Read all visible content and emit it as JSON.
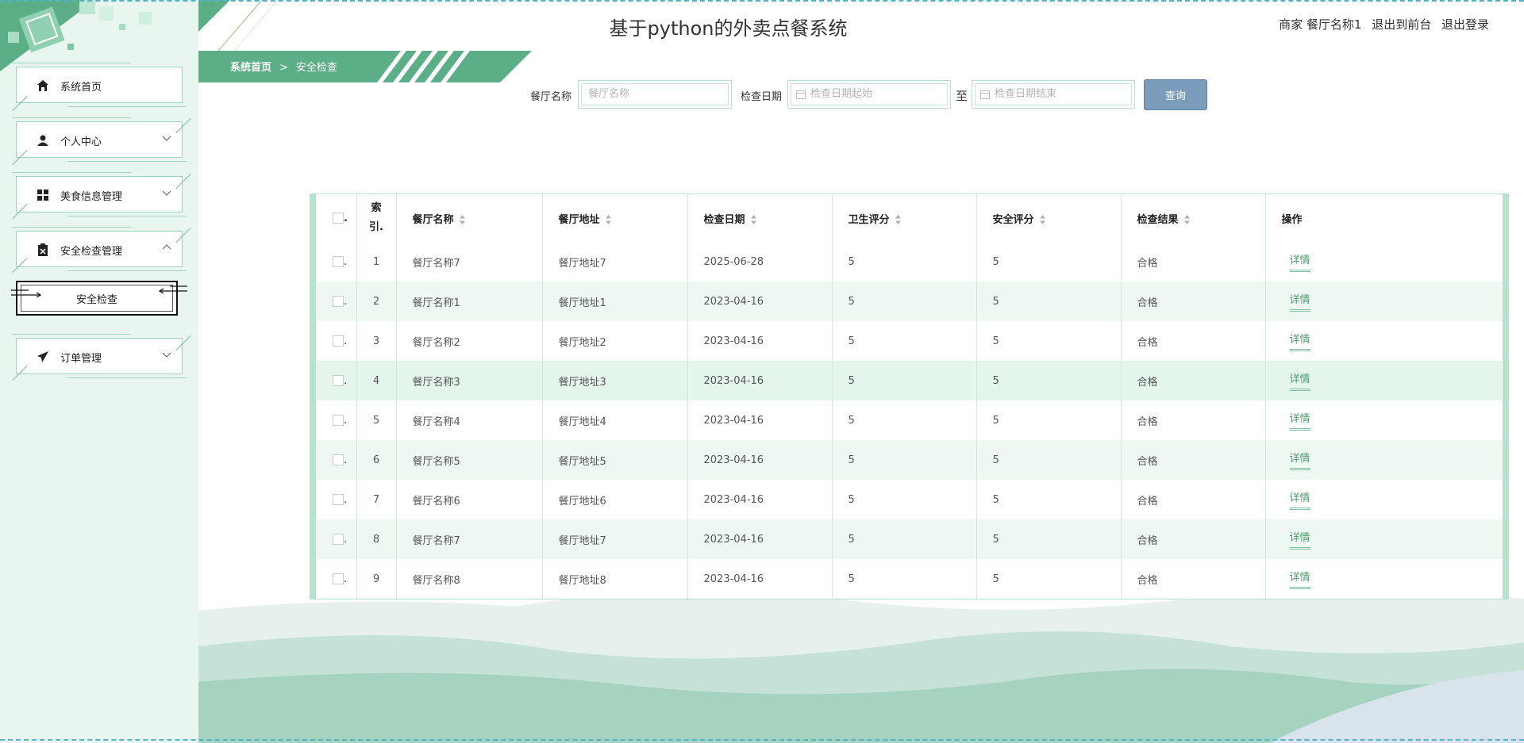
{
  "app": {
    "title": "基于python的外卖点餐系统",
    "user": "商家 餐厅名称1",
    "to_front": "退出到前台",
    "logout": "退出登录"
  },
  "breadcrumb": {
    "home": "系统首页",
    "sep": ">",
    "current": "安全检查"
  },
  "sidebar": {
    "items": [
      {
        "label": "系统首页",
        "icon": "home-icon"
      },
      {
        "label": "个人中心",
        "icon": "person-icon"
      },
      {
        "label": "美食信息管理",
        "icon": "grid-icon"
      },
      {
        "label": "安全检查管理",
        "icon": "clipboard-icon"
      },
      {
        "label": "订单管理",
        "icon": "send-icon"
      }
    ],
    "sub_item": "安全检查"
  },
  "search": {
    "name_label": "餐厅名称",
    "name_placeholder": "餐厅名称",
    "date_label": "检查日期",
    "date_start_placeholder": "检查日期起始",
    "to": "至",
    "date_end_placeholder": "检查日期结束",
    "query_button": "查询"
  },
  "table": {
    "headers": {
      "checkbox": ".",
      "index": "索引.",
      "name": "餐厅名称",
      "address": "餐厅地址",
      "date": "检查日期",
      "hygiene": "卫生评分",
      "safety": "安全评分",
      "result": "检查结果",
      "actions": "操作"
    },
    "detail_label": "详情",
    "rows": [
      {
        "idx": "1",
        "name": "餐厅名称7",
        "address": "餐厅地址7",
        "date": "2025-06-28",
        "hygiene": "5",
        "safety": "5",
        "result": "合格"
      },
      {
        "idx": "2",
        "name": "餐厅名称1",
        "address": "餐厅地址1",
        "date": "2023-04-16",
        "hygiene": "5",
        "safety": "5",
        "result": "合格"
      },
      {
        "idx": "3",
        "name": "餐厅名称2",
        "address": "餐厅地址2",
        "date": "2023-04-16",
        "hygiene": "5",
        "safety": "5",
        "result": "合格"
      },
      {
        "idx": "4",
        "name": "餐厅名称3",
        "address": "餐厅地址3",
        "date": "2023-04-16",
        "hygiene": "5",
        "safety": "5",
        "result": "合格"
      },
      {
        "idx": "5",
        "name": "餐厅名称4",
        "address": "餐厅地址4",
        "date": "2023-04-16",
        "hygiene": "5",
        "safety": "5",
        "result": "合格"
      },
      {
        "idx": "6",
        "name": "餐厅名称5",
        "address": "餐厅地址5",
        "date": "2023-04-16",
        "hygiene": "5",
        "safety": "5",
        "result": "合格"
      },
      {
        "idx": "7",
        "name": "餐厅名称6",
        "address": "餐厅地址6",
        "date": "2023-04-16",
        "hygiene": "5",
        "safety": "5",
        "result": "合格"
      },
      {
        "idx": "8",
        "name": "餐厅名称7",
        "address": "餐厅地址7",
        "date": "2023-04-16",
        "hygiene": "5",
        "safety": "5",
        "result": "合格"
      },
      {
        "idx": "9",
        "name": "餐厅名称8",
        "address": "餐厅地址8",
        "date": "2023-04-16",
        "hygiene": "5",
        "safety": "5",
        "result": "合格"
      }
    ]
  },
  "colors": {
    "accent": "#5cae86",
    "sidebar_bg": "#e9f6f0",
    "query_btn": "#7b9cba",
    "link": "#4c9a6e"
  }
}
